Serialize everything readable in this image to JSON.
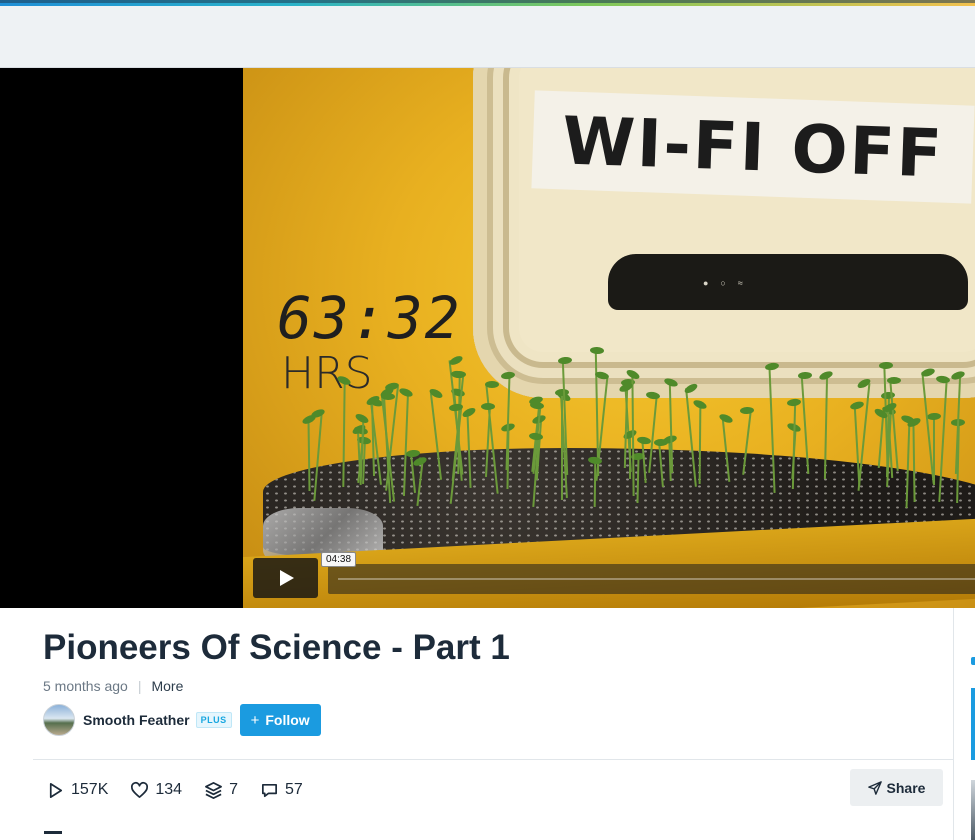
{
  "video": {
    "overlay_sign": "WI-FI OFF",
    "overlay_timer": "63:32",
    "overlay_timer_unit": "HRS",
    "hover_time": "04:38"
  },
  "title": "Pioneers Of Science - Part 1",
  "meta": {
    "posted": "5 months ago",
    "more_label": "More"
  },
  "author": {
    "name": "Smooth Feather",
    "badge": "PLUS",
    "follow_label": "Follow"
  },
  "stats": {
    "plays": "157K",
    "likes": "134",
    "collections": "7",
    "comments": "57"
  },
  "actions": {
    "share_label": "Share"
  },
  "colors": {
    "accent": "#1b9be0",
    "text": "#1d2b3a",
    "muted": "#6b7885"
  }
}
